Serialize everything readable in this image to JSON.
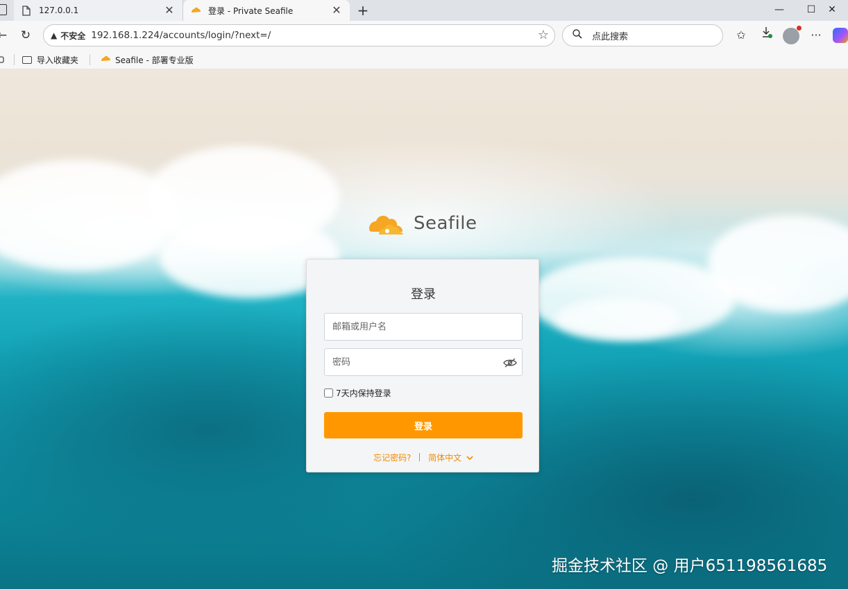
{
  "browser": {
    "tabs": [
      {
        "title": "127.0.0.1",
        "active": false
      },
      {
        "title": "登录 - Private Seafile",
        "active": true
      }
    ],
    "new_tab_label": "+",
    "window_controls": {
      "minimize": "—",
      "maximize": "☐",
      "close": "✕"
    },
    "address": {
      "security_label": "不安全",
      "url": "192.168.1.224/accounts/login/?next=/"
    },
    "search_placeholder": "点此搜索",
    "bookmarks": [
      {
        "label": "导入收藏夹",
        "icon": "folder-icon"
      },
      {
        "label": "Seafile - 部署专业版",
        "icon": "seafile-icon"
      }
    ],
    "accent_color": "#ff9800"
  },
  "page": {
    "logo_text": "Seafile",
    "login": {
      "title": "登录",
      "username_placeholder": "邮箱或用户名",
      "password_placeholder": "密码",
      "remember_label": "7天内保持登录",
      "submit_label": "登录",
      "forgot_label": "忘记密码?",
      "language_label": "简体中文"
    },
    "watermark": "掘金技术社区 @ 用户651198561685"
  }
}
